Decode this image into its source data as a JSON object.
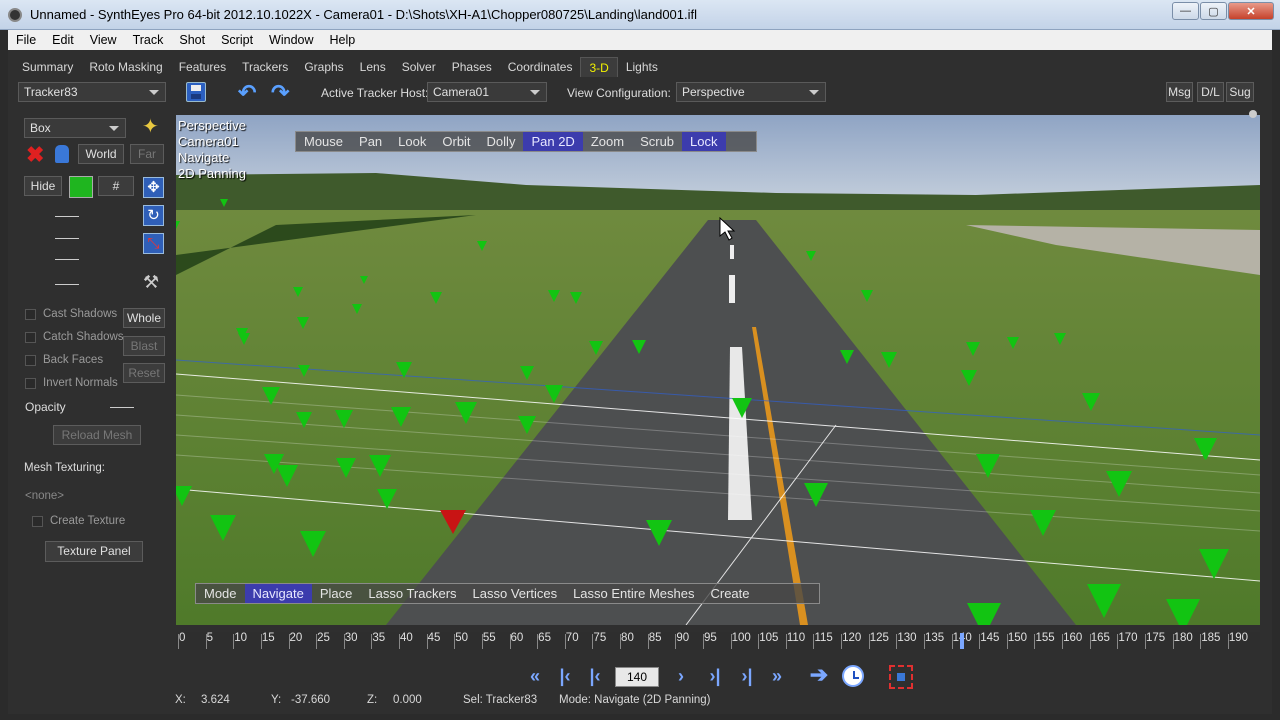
{
  "window": {
    "title": "Unnamed - SynthEyes Pro 64-bit 2012.10.1022X - Camera01 - D:\\Shots\\XH-A1\\Chopper080725\\Landing\\land001.ifl",
    "min": "—",
    "max": "▢",
    "close": "✕"
  },
  "menu": [
    "File",
    "Edit",
    "View",
    "Track",
    "Shot",
    "Script",
    "Window",
    "Help"
  ],
  "tabs": [
    "Summary",
    "Roto Masking",
    "Features",
    "Trackers",
    "Graphs",
    "Lens",
    "Solver",
    "Phases",
    "Coordinates",
    "3-D",
    "Lights"
  ],
  "active_tab": "3-D",
  "toolbar": {
    "tracker_combo": "Tracker83",
    "host_label": "Active Tracker Host:",
    "host_value": "Camera01",
    "view_config_label": "View Configuration:",
    "view_config_value": "Perspective",
    "msg": "Msg",
    "dl": "D/L",
    "sug": "Sug"
  },
  "left_panel": {
    "mesh_type": "Box",
    "world": "World",
    "far": "Far",
    "hide": "Hide",
    "hash": "#",
    "whole": "Whole",
    "blast": "Blast",
    "reset": "Reset",
    "cast_shadows": "Cast Shadows",
    "catch_shadows": "Catch Shadows",
    "back_faces": "Back Faces",
    "invert_normals": "Invert Normals",
    "opacity": "Opacity",
    "reload_mesh": "Reload Mesh",
    "mesh_texturing": "Mesh Texturing:",
    "none": "<none>",
    "create_texture": "Create Texture",
    "texture_panel": "Texture Panel",
    "swatch_color": "#1fb51f"
  },
  "viewport": {
    "info": [
      "Perspective",
      "Camera01",
      "Navigate",
      "2D Panning"
    ],
    "top_bar": [
      "Mouse",
      "Pan",
      "Look",
      "Orbit",
      "Dolly",
      "Pan 2D",
      "Zoom",
      "Scrub",
      "Lock"
    ],
    "top_bar_selected": [
      "Pan 2D",
      "Lock"
    ],
    "bottom_bar": [
      "Mode",
      "Navigate",
      "Place",
      "Lasso Trackers",
      "Lasso Vertices",
      "Lasso Entire Meshes",
      "Create"
    ],
    "bottom_bar_selected": [
      "Navigate"
    ],
    "tracker_color": "#12c412",
    "selected_tracker_color": "#c81414"
  },
  "timeline": {
    "ticks": [
      "0",
      "5",
      "10",
      "15",
      "20",
      "25",
      "30",
      "35",
      "40",
      "45",
      "50",
      "55",
      "60",
      "65",
      "70",
      "75",
      "80",
      "85",
      "90",
      "95",
      "100",
      "105",
      "110",
      "115",
      "120",
      "125",
      "130",
      "135",
      "140",
      "145",
      "150",
      "155",
      "160",
      "165",
      "170",
      "175",
      "180",
      "185",
      "190"
    ],
    "current": "140"
  },
  "playback": {
    "frame": "140"
  },
  "status": {
    "x_label": "X:",
    "x": "3.624",
    "y_label": "Y:",
    "y": "-37.660",
    "z_label": "Z:",
    "z": "0.000",
    "sel": "Sel: Tracker83",
    "mode": "Mode: Navigate (2D Panning)"
  }
}
